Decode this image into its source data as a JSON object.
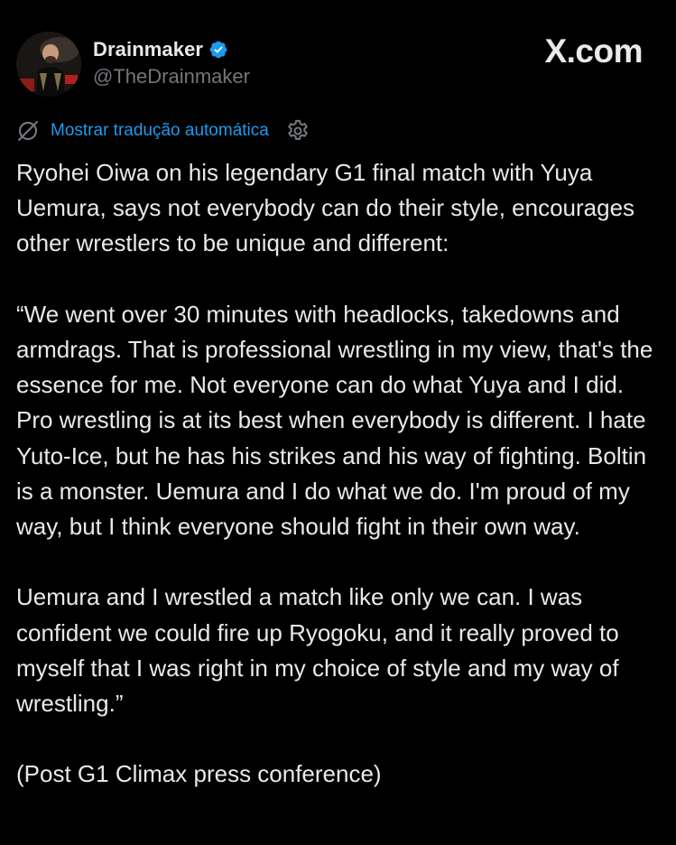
{
  "brand": {
    "label": "X.com"
  },
  "author": {
    "display_name": "Drainmaker",
    "handle": "@TheDrainmaker",
    "verified": true,
    "verified_color": "#1d9bf0"
  },
  "translate": {
    "label": "Mostrar tradução automática",
    "link_color": "#1d9bf0",
    "icon": "no-translate-icon",
    "settings_icon": "gear-icon"
  },
  "tweet": {
    "paragraphs": [
      "Ryohei Oiwa on his legendary G1 final match with Yuya Uemura, says not everybody can do their style, encourages other wrestlers to be unique and different:",
      "“We went over 30 minutes with headlocks, takedowns and armdrags. That is professional wrestling in my view, that's the essence for me. Not everyone can do what Yuya and I did. Pro wrestling is at its best when everybody is different. I hate Yuto-Ice, but he has his strikes and his way of fighting. Boltin is a monster. Uemura and I do what we do. I'm proud of my way, but I think everyone should fight in their own way.",
      "Uemura and I wrestled a match like only we can. I was confident we could fire up Ryogoku, and it really proved to myself that I was right in my choice of style and my way of wrestling.”",
      "(Post G1 Climax press conference)"
    ]
  },
  "colors": {
    "background": "#000000",
    "text": "#e7e9ea",
    "secondary_text": "#71767b"
  }
}
